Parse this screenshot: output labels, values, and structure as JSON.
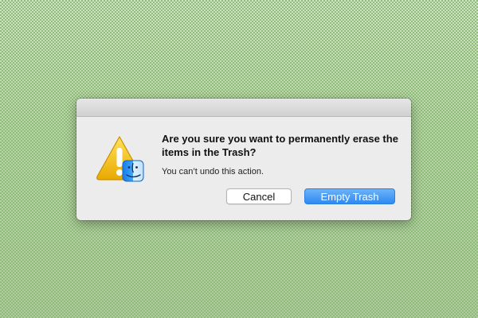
{
  "dialog": {
    "headline": "Are you sure you want to permanently erase the items in the Trash?",
    "subtext": "You can’t undo this action.",
    "icon": "warning-finder-icon"
  },
  "buttons": {
    "cancel_label": "Cancel",
    "confirm_label": "Empty Trash"
  },
  "colors": {
    "accent": "#2f8af0",
    "warning": "#f5c000"
  }
}
